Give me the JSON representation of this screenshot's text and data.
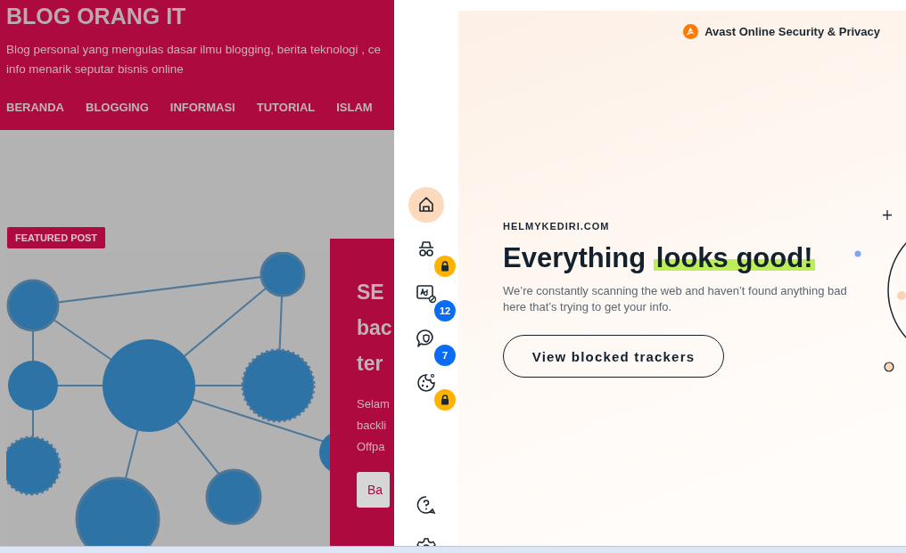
{
  "blog": {
    "title": "BLOG ORANG IT",
    "tagline": [
      "Blog personal yang mengulas dasar ilmu blogging, berita teknologi , ce",
      "info menarik seputar bisnis online"
    ],
    "nav": [
      {
        "label": "BERANDA"
      },
      {
        "label": "BLOGGING"
      },
      {
        "label": "INFORMASI"
      },
      {
        "label": "TUTORIAL"
      },
      {
        "label": "ISLAM"
      }
    ],
    "featured": {
      "badge": "FEATURED POST",
      "title_lines": [
        "SE",
        "bac",
        "ter"
      ],
      "excerpt_lines": [
        "Selam",
        "backli",
        "Offpa"
      ],
      "button": "Ba"
    }
  },
  "extension": {
    "brand": "Avast Online Security & Privacy",
    "sidebar": [
      {
        "kind": "home",
        "selected": true
      },
      {
        "kind": "incognito",
        "selected": false,
        "badge": {
          "kind": "lock"
        }
      },
      {
        "kind": "ad",
        "selected": false,
        "badge": {
          "kind": "count",
          "text": "12"
        }
      },
      {
        "kind": "shield-chat",
        "selected": false,
        "badge": {
          "kind": "count",
          "text": "7"
        }
      },
      {
        "kind": "cookie",
        "selected": false,
        "badge": {
          "kind": "lock"
        }
      }
    ],
    "sidebar_footer": [
      {
        "kind": "help"
      },
      {
        "kind": "settings"
      }
    ],
    "site": "HELMYKEDIRI.COM",
    "heading": {
      "lead": "Everything",
      "highlight": "looks good!"
    },
    "message": "We’re constantly scanning the web and haven’t found anything bad here that’s trying to get your info.",
    "button": "View blocked trackers"
  }
}
